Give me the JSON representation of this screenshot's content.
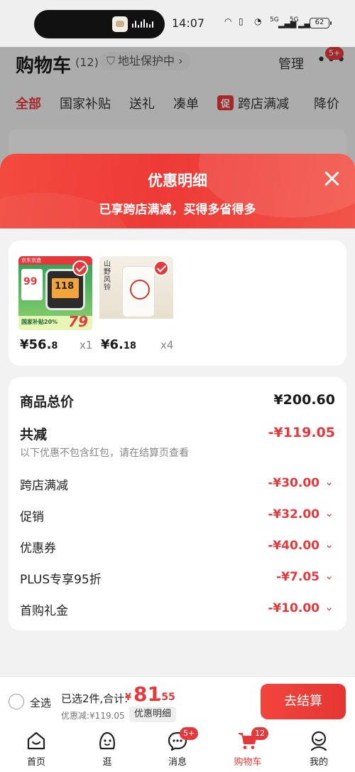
{
  "status_bar": {
    "time": "14:07",
    "battery": "62",
    "signal_1": "5G",
    "signal_2": "5G"
  },
  "header": {
    "title": "购物车",
    "count": "(12)",
    "address_protect": "地址保护中",
    "manage": "管理",
    "more_badge": "5+"
  },
  "tabs": [
    {
      "label": "全部",
      "active": true
    },
    {
      "label": "国家补贴"
    },
    {
      "label": "送礼"
    },
    {
      "label": "凑单"
    },
    {
      "label": "跨店满减",
      "tag": "促"
    },
    {
      "label": "降价"
    }
  ],
  "sheet": {
    "title": "优惠明细",
    "subtitle": "已享跨店满减，买得多省得多"
  },
  "products": [
    {
      "price_int": "¥56.",
      "price_dec": "8",
      "qty": "x1",
      "thumb_brand": "京东京造",
      "thumb_discount": "99",
      "thumb_screen": "118",
      "thumb_price": "79",
      "thumb_tag": "国家补贴20%"
    },
    {
      "price_int": "¥6.",
      "price_dec": "18",
      "qty": "x4",
      "thumb_text": "山野风铃"
    }
  ],
  "summary": {
    "total_label": "商品总价",
    "total_value": "¥200.60",
    "reduce_label": "共减",
    "reduce_value": "-¥119.05",
    "note": "以下优惠不包含红包，请在结算页查看",
    "items": [
      {
        "label": "跨店满减",
        "value": "-¥30.00"
      },
      {
        "label": "促销",
        "value": "-¥32.00"
      },
      {
        "label": "优惠券",
        "value": "-¥40.00"
      },
      {
        "label": "PLUS专享95折",
        "value": "-¥7.05"
      },
      {
        "label": "首购礼金",
        "value": "-¥10.00"
      }
    ]
  },
  "checkout": {
    "select_all": "全选",
    "selected_text": "已选2件,合计:",
    "yen": "¥",
    "amount_int": "81",
    "amount_dec": ".55",
    "saved_text": "优惠减:¥119.05",
    "detail_chip": "优惠明细",
    "pay_button": "去结算"
  },
  "tabbar": [
    {
      "label": "首页",
      "icon": "home-icon"
    },
    {
      "label": "逛",
      "icon": "browse-icon"
    },
    {
      "label": "消息",
      "icon": "message-icon",
      "badge": "5+"
    },
    {
      "label": "购物车",
      "icon": "cart-icon",
      "badge": "12",
      "active": true
    },
    {
      "label": "我的",
      "icon": "profile-icon"
    }
  ],
  "colors": {
    "brand_red": "#e4393c",
    "sheet_header": "#ee3a36",
    "background": "#f2f2f2"
  }
}
